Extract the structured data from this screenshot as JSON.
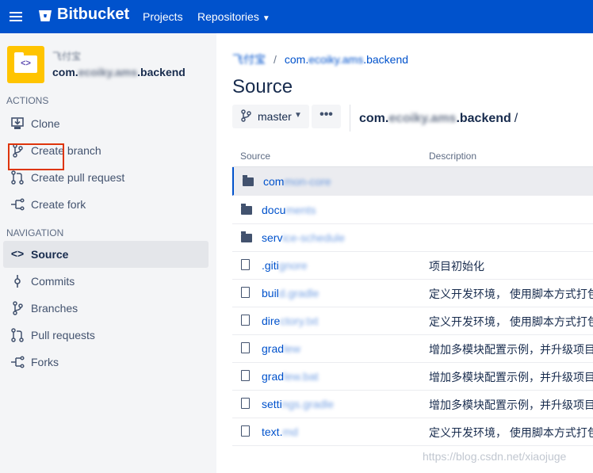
{
  "topbar": {
    "brand": "Bitbucket",
    "nav": [
      {
        "label": "Projects"
      },
      {
        "label": "Repositories"
      }
    ]
  },
  "sidebar": {
    "project_name": "飞付宝",
    "repo_name_prefix": "com.",
    "repo_name_hidden": "ecoiky.ams",
    "repo_name_suffix": ".backend",
    "actions_title": "ACTIONS",
    "actions": [
      {
        "label": "Clone",
        "icon": "clone-icon"
      },
      {
        "label": "Create branch",
        "icon": "branch-icon"
      },
      {
        "label": "Create pull request",
        "icon": "pull-request-icon"
      },
      {
        "label": "Create fork",
        "icon": "fork-icon"
      }
    ],
    "navigation_title": "NAVIGATION",
    "navigation": [
      {
        "label": "Source",
        "icon": "code-icon",
        "active": true
      },
      {
        "label": "Commits",
        "icon": "commit-icon"
      },
      {
        "label": "Branches",
        "icon": "branch-icon"
      },
      {
        "label": "Pull requests",
        "icon": "pull-request-icon"
      },
      {
        "label": "Forks",
        "icon": "fork-icon"
      }
    ]
  },
  "main": {
    "breadcrumb": {
      "project": "飞付宝",
      "repo_prefix": "com.",
      "repo_hidden": "ecoiky.ams",
      "repo_suffix": ".backend"
    },
    "title": "Source",
    "branch": "master",
    "more": "•••",
    "path_prefix": "com.",
    "path_hidden": "ecoiky.ams",
    "path_suffix": ".backend",
    "path_slash": "/",
    "columns": {
      "source": "Source",
      "description": "Description"
    },
    "rows": [
      {
        "type": "folder",
        "prefix": "com",
        "hidden": "mon-core",
        "desc": ""
      },
      {
        "type": "folder",
        "prefix": "docu",
        "hidden": "ments",
        "desc": ""
      },
      {
        "type": "folder",
        "prefix": "serv",
        "hidden": "ice-schedule",
        "desc": ""
      },
      {
        "type": "file",
        "prefix": ".giti",
        "hidden": "gnore",
        "desc": "项目初始化"
      },
      {
        "type": "file",
        "prefix": "buil",
        "hidden": "d.gradle",
        "desc": "定义开发环境， 使用脚本方式打包"
      },
      {
        "type": "file",
        "prefix": "dire",
        "hidden": "ctory.txt",
        "desc": "定义开发环境， 使用脚本方式打包"
      },
      {
        "type": "file",
        "prefix": "grad",
        "hidden": "lew",
        "desc": "增加多模块配置示例，并升级项目"
      },
      {
        "type": "file",
        "prefix": "grad",
        "hidden": "lew.bat",
        "desc": "增加多模块配置示例，并升级项目"
      },
      {
        "type": "file",
        "prefix": "setti",
        "hidden": "ngs.gradle",
        "desc": "增加多模块配置示例，并升级项目"
      },
      {
        "type": "file",
        "prefix": "text.",
        "hidden": "md",
        "desc": "定义开发环境， 使用脚本方式打包"
      }
    ]
  },
  "watermark": "https://blog.csdn.net/xiaojuge"
}
